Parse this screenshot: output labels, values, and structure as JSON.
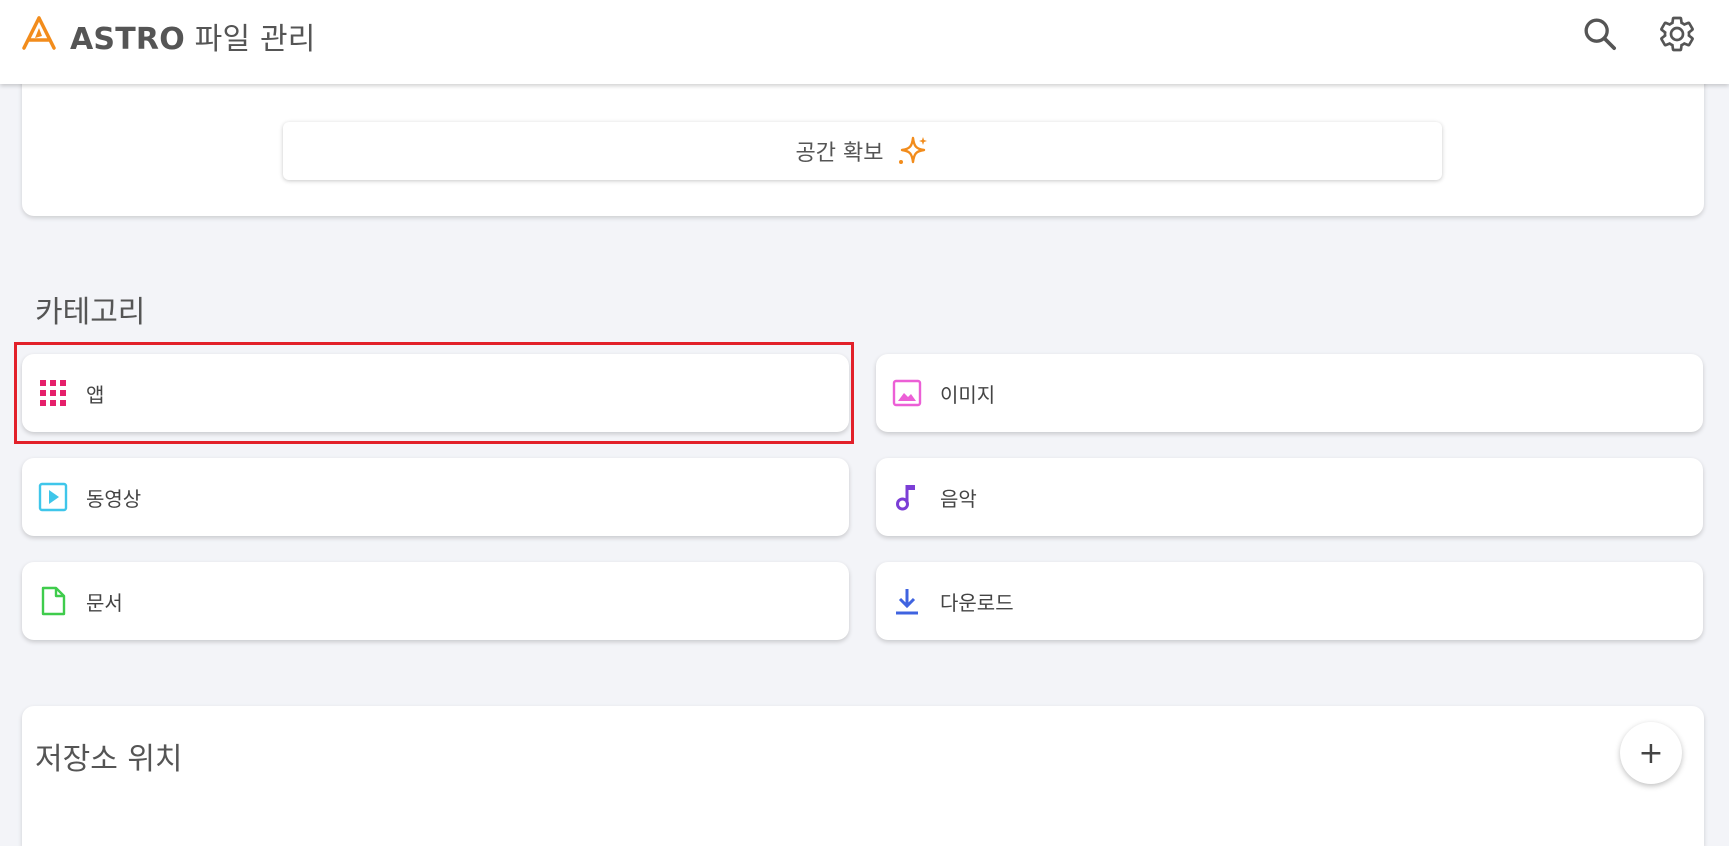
{
  "app": {
    "brand": "ASTRO",
    "title_suffix": "파일 관리"
  },
  "storage": {
    "free_space_label": "공간 확보"
  },
  "categories": {
    "title": "카테고리",
    "items": [
      {
        "label": "앱",
        "icon": "apps-grid-icon",
        "color": "#e5206b"
      },
      {
        "label": "이미지",
        "icon": "image-icon",
        "color": "#ec5fd6"
      },
      {
        "label": "동영상",
        "icon": "video-icon",
        "color": "#3fc6ea"
      },
      {
        "label": "음악",
        "icon": "music-note-icon",
        "color": "#7b3ed6"
      },
      {
        "label": "문서",
        "icon": "document-icon",
        "color": "#3fcc4c"
      },
      {
        "label": "다운로드",
        "icon": "download-icon",
        "color": "#3f63e0"
      }
    ]
  },
  "locations": {
    "title": "저장소 위치",
    "add_label": "+"
  },
  "colors": {
    "accent": "#f28c1c",
    "highlight": "#e2202a",
    "background": "#f3f4f8"
  }
}
